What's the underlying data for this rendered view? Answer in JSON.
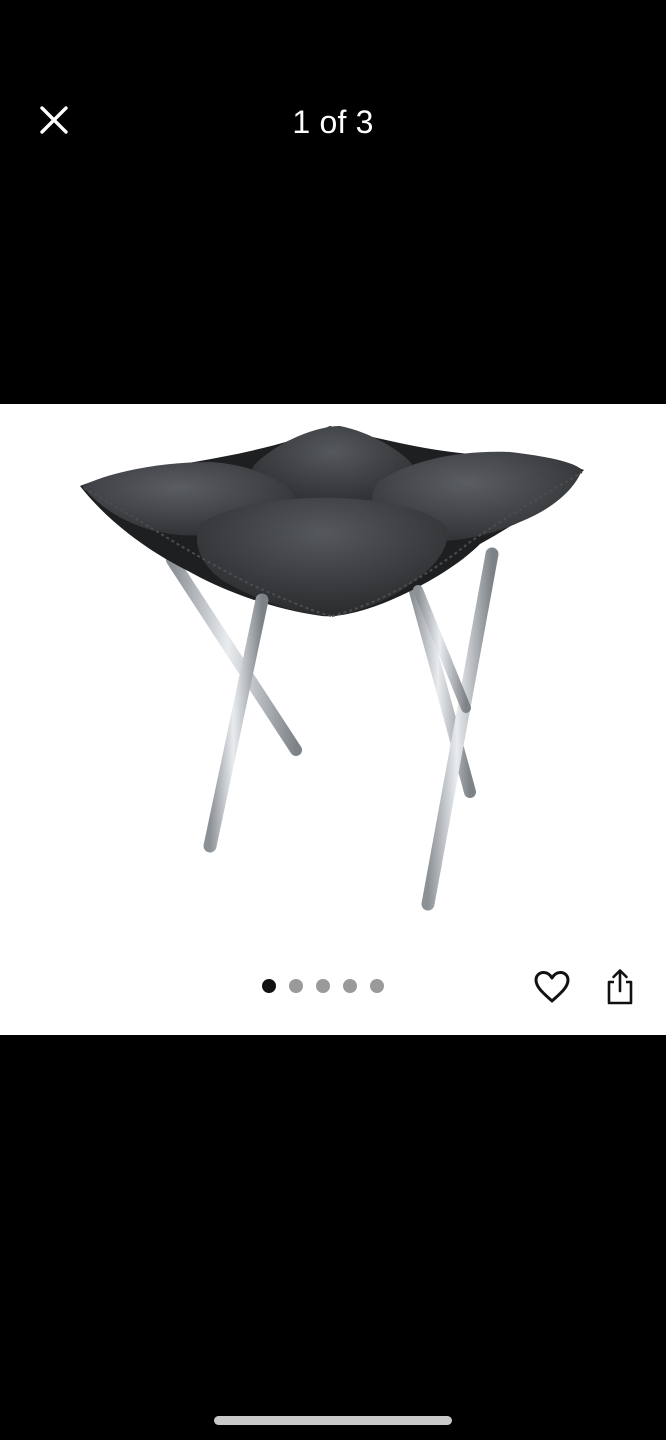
{
  "header": {
    "counter_text": "1 of 3",
    "close_icon": "close-icon"
  },
  "gallery": {
    "image_subject": "folding-stool-with-gray-cushion",
    "dots_count": 5,
    "active_dot": 1
  },
  "actions": {
    "favorite_icon": "heart-outline-icon",
    "share_icon": "share-icon"
  },
  "colors": {
    "background": "#000000",
    "panel": "#ffffff",
    "dot_active": "#111111",
    "dot_inactive": "#9a9a9a"
  }
}
